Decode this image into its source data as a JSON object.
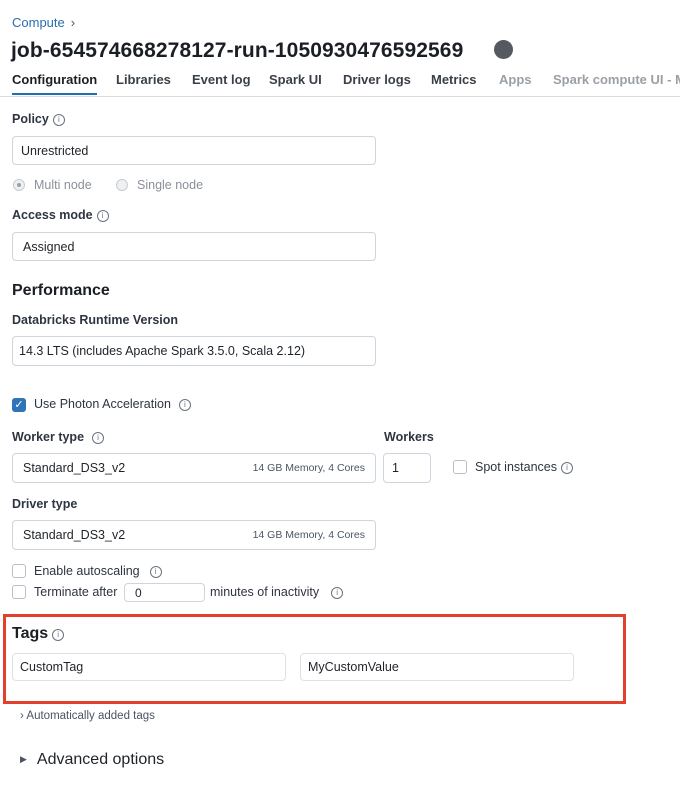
{
  "breadcrumb": {
    "parent": "Compute",
    "chevron": "›"
  },
  "title": "job-654574668278127-run-1050930476592569",
  "tabs": [
    "Configuration",
    "Libraries",
    "Event log",
    "Spark UI",
    "Driver logs",
    "Metrics",
    "Apps",
    "Spark compute UI - M"
  ],
  "policy": {
    "label": "Policy",
    "value": "Unrestricted"
  },
  "node_mode": {
    "multi": "Multi node",
    "single": "Single node"
  },
  "access_mode": {
    "label": "Access mode",
    "value": "Assigned"
  },
  "performance": {
    "heading": "Performance",
    "runtime_label": "Databricks Runtime Version",
    "runtime_value": "14.3 LTS (includes Apache Spark 3.5.0, Scala 2.12)",
    "photon_label": "Use Photon Acceleration"
  },
  "worker": {
    "type_label": "Worker type",
    "type_value": "Standard_DS3_v2",
    "type_spec": "14 GB Memory, 4 Cores",
    "workers_label": "Workers",
    "workers_value": "1",
    "spot_label": "Spot instances"
  },
  "driver": {
    "type_label": "Driver type",
    "type_value": "Standard_DS3_v2",
    "type_spec": "14 GB Memory, 4 Cores"
  },
  "autoscaling_label": "Enable autoscaling",
  "terminate": {
    "prefix": "Terminate after",
    "value": "0",
    "suffix": "minutes of inactivity"
  },
  "tags": {
    "heading": "Tags",
    "key": "CustomTag",
    "value": "MyCustomValue"
  },
  "auto_tags_label": "Automatically added tags",
  "advanced_label": "Advanced options",
  "icons": {
    "info": "i",
    "check": "✓",
    "chevron_right": "›",
    "triangle_right": "▶"
  },
  "colors": {
    "highlight": "#e2402d",
    "accent": "#2f73b8",
    "link": "#2a6fb0"
  }
}
